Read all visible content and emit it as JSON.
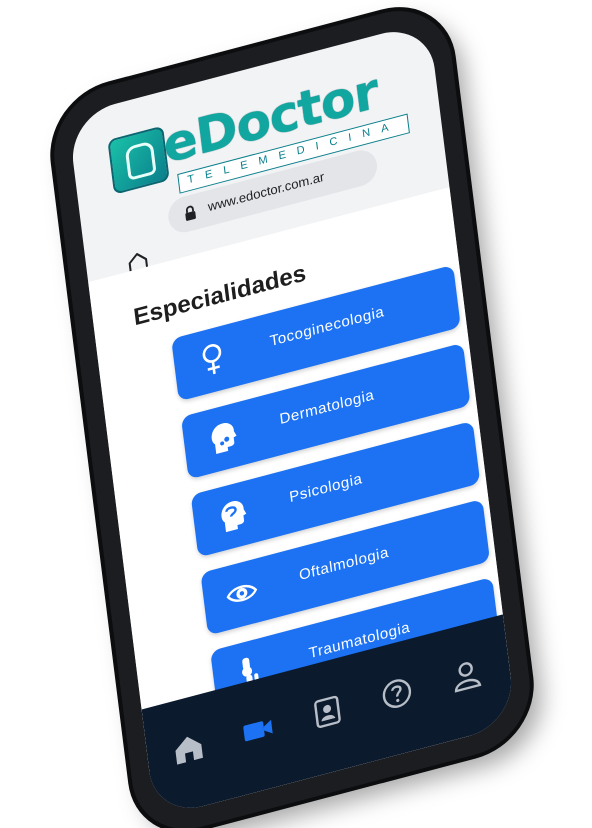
{
  "brand": {
    "name": "eDoctor",
    "tagline": "TELEMEDICINA"
  },
  "browser": {
    "url": "www.edoctor.com.ar"
  },
  "page": {
    "title": "Especialidades"
  },
  "specialties": [
    {
      "label": "Tocoginecologia",
      "icon": "venus-icon"
    },
    {
      "label": "Dermatologia",
      "icon": "head-profile-icon"
    },
    {
      "label": "Psicologia",
      "icon": "head-mind-icon"
    },
    {
      "label": "Oftalmologia",
      "icon": "eye-icon"
    },
    {
      "label": "Traumatologia",
      "icon": "bone-joint-icon"
    }
  ],
  "tabbar": {
    "items": [
      {
        "icon": "home-icon"
      },
      {
        "icon": "video-call-icon",
        "active": true
      },
      {
        "icon": "contacts-icon"
      },
      {
        "icon": "help-icon"
      },
      {
        "icon": "user-icon"
      }
    ]
  },
  "colors": {
    "accent": "#1c72f2",
    "brand": "#11a7a0",
    "tabbar": "#0b1a2d",
    "active_tab": "#1c72f2"
  }
}
